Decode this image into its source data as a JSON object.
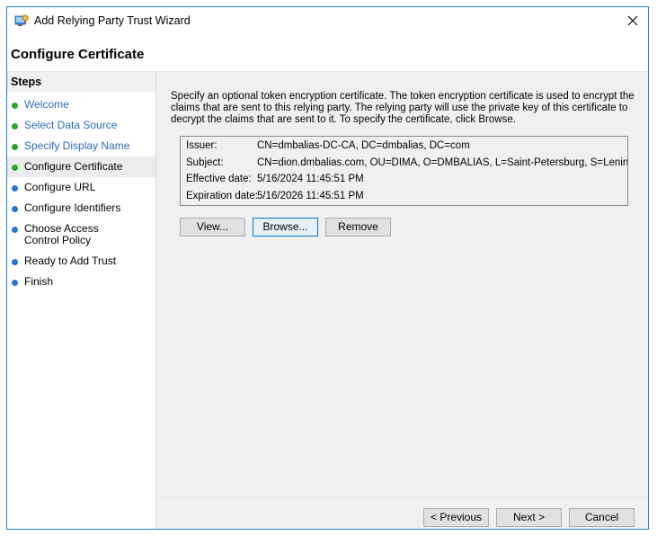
{
  "window": {
    "title": "Add Relying Party Trust Wizard",
    "close_glyph": "✕"
  },
  "header": {
    "page_title": "Configure Certificate"
  },
  "sidebar": {
    "heading": "Steps",
    "steps": [
      {
        "label": "Welcome",
        "state": "done"
      },
      {
        "label": "Select Data Source",
        "state": "done"
      },
      {
        "label": "Specify Display Name",
        "state": "done"
      },
      {
        "label": "Configure Certificate",
        "state": "current"
      },
      {
        "label": "Configure URL",
        "state": "pending"
      },
      {
        "label": "Configure Identifiers",
        "state": "pending"
      },
      {
        "label": "Choose Access Control Policy",
        "state": "pending"
      },
      {
        "label": "Ready to Add Trust",
        "state": "pending"
      },
      {
        "label": "Finish",
        "state": "pending"
      }
    ]
  },
  "main": {
    "description": "Specify an optional token encryption certificate.  The token encryption certificate is used to encrypt the claims that are sent to this relying party.  The relying party will use the private key of this certificate to decrypt the claims that are sent to it.  To specify the certificate, click Browse.",
    "certificate": {
      "issuer_label": "Issuer:",
      "issuer_value": "CN=dmbalias-DC-CA, DC=dmbalias, DC=com",
      "subject_label": "Subject:",
      "subject_value": "CN=dion.dmbalias.com, OU=DIMA, O=DMBALIAS, L=Saint-Petersburg, S=Leningrad, C",
      "effective_label": "Effective date:",
      "effective_value": "5/16/2024 11:45:51 PM",
      "expiration_label": "Expiration date:",
      "expiration_value": "5/16/2026 11:45:51 PM"
    },
    "buttons": {
      "view": "View...",
      "browse": "Browse...",
      "remove": "Remove"
    }
  },
  "footer": {
    "previous": "< Previous",
    "next": "Next >",
    "cancel": "Cancel"
  },
  "colors": {
    "step_done": "#2fa12f",
    "step_pending": "#2a74d0",
    "step_done_text": "#2f6bb5",
    "window_border": "#1883d7"
  },
  "icons": {
    "app": "relying-party-wizard-icon",
    "close": "close-icon"
  }
}
